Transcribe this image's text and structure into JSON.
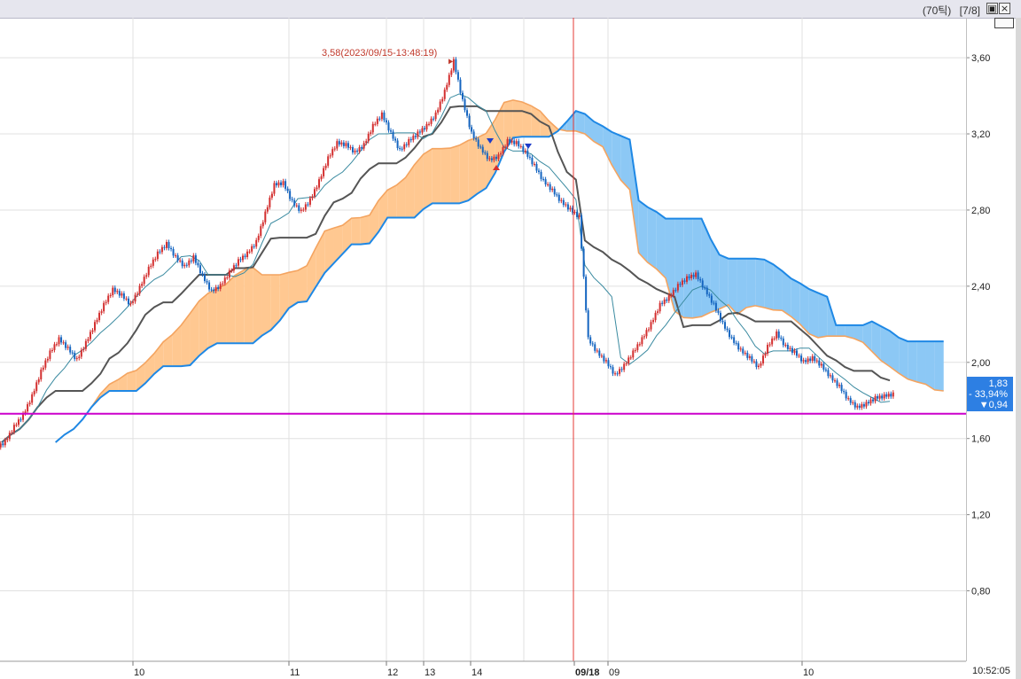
{
  "header": {
    "period_label": "(70틱)",
    "page_label": "[7/8]",
    "restore_icon": "window-restore-icon",
    "close_label": "×"
  },
  "colors": {
    "background": "#ffffff",
    "grid": "#e0e0e0",
    "candle_up": "#d32f2f",
    "candle_down": "#1565c0",
    "base_line": "#555555",
    "conversion_line": "#3a8aa0",
    "span_a": "#f4a460",
    "span_b": "#1e88e5",
    "cloud_bull": "#ffc891",
    "cloud_bear": "#8cc8f5",
    "support_line": "#cc00cc",
    "cursor_line": "#e53935",
    "badge": "#2d7fe3"
  },
  "chart_data": {
    "type": "candlestick",
    "indicator": "ichimoku",
    "y_ticks": [
      "3,60",
      "3,20",
      "2,80",
      "2,40",
      "2,00",
      "1,60",
      "1,20",
      "0,80"
    ],
    "y_tick_values": [
      3.6,
      3.2,
      2.8,
      2.4,
      2.0,
      1.6,
      1.2,
      0.8
    ],
    "ylim": [
      0.43,
      3.81
    ],
    "x_labels": [
      {
        "label": "10",
        "index": 0.0
      },
      {
        "label": "11",
        "index": 0.0
      },
      {
        "label": "12",
        "index": 0.0
      },
      {
        "label": "13",
        "index": 0.0
      },
      {
        "label": "14",
        "index": 0.0
      },
      {
        "label": "09/18",
        "index": 0.0
      },
      {
        "label": "09",
        "index": 0.0
      },
      {
        "label": "10",
        "index": 0.0
      }
    ],
    "x_labels_rendered": [
      "10",
      "11",
      "12",
      "13",
      "14",
      "09/18",
      "09",
      "10"
    ],
    "close_points": [
      [
        0,
        1.58
      ],
      [
        1,
        1.66
      ],
      [
        2,
        1.72
      ],
      [
        3,
        1.82
      ],
      [
        4,
        1.95
      ],
      [
        5,
        2.05
      ],
      [
        6,
        2.12
      ],
      [
        7,
        2.07
      ],
      [
        8,
        2.01
      ],
      [
        9,
        2.1
      ],
      [
        10,
        2.2
      ],
      [
        11,
        2.3
      ],
      [
        12,
        2.38
      ],
      [
        13,
        2.35
      ],
      [
        14,
        2.3
      ],
      [
        15,
        2.39
      ],
      [
        16,
        2.49
      ],
      [
        17,
        2.57
      ],
      [
        18,
        2.62
      ],
      [
        19,
        2.55
      ],
      [
        20,
        2.5
      ],
      [
        21,
        2.55
      ],
      [
        22,
        2.45
      ],
      [
        23,
        2.37
      ],
      [
        24,
        2.4
      ],
      [
        25,
        2.47
      ],
      [
        26,
        2.53
      ],
      [
        27,
        2.57
      ],
      [
        28,
        2.63
      ],
      [
        29,
        2.78
      ],
      [
        30,
        2.93
      ],
      [
        31,
        2.94
      ],
      [
        32,
        2.84
      ],
      [
        33,
        2.79
      ],
      [
        34,
        2.85
      ],
      [
        35,
        2.95
      ],
      [
        36,
        3.07
      ],
      [
        37,
        3.15
      ],
      [
        38,
        3.14
      ],
      [
        39,
        3.1
      ],
      [
        40,
        3.14
      ],
      [
        41,
        3.24
      ],
      [
        42,
        3.3
      ],
      [
        43,
        3.2
      ],
      [
        44,
        3.11
      ],
      [
        45,
        3.16
      ],
      [
        46,
        3.2
      ],
      [
        47,
        3.24
      ],
      [
        48,
        3.3
      ],
      [
        49,
        3.42
      ],
      [
        50,
        3.58
      ],
      [
        51,
        3.37
      ],
      [
        52,
        3.2
      ],
      [
        53,
        3.12
      ],
      [
        54,
        3.06
      ],
      [
        55,
        3.08
      ],
      [
        56,
        3.16
      ],
      [
        57,
        3.15
      ],
      [
        58,
        3.1
      ],
      [
        59,
        3.03
      ],
      [
        60,
        2.95
      ],
      [
        61,
        2.9
      ],
      [
        62,
        2.84
      ],
      [
        63,
        2.8
      ],
      [
        64,
        2.76
      ],
      [
        65,
        2.12
      ],
      [
        66,
        2.05
      ],
      [
        67,
        2.0
      ],
      [
        68,
        1.93
      ],
      [
        69,
        1.98
      ],
      [
        70,
        2.05
      ],
      [
        71,
        2.12
      ],
      [
        72,
        2.2
      ],
      [
        73,
        2.3
      ],
      [
        74,
        2.34
      ],
      [
        75,
        2.4
      ],
      [
        76,
        2.44
      ],
      [
        77,
        2.46
      ],
      [
        78,
        2.38
      ],
      [
        79,
        2.3
      ],
      [
        80,
        2.2
      ],
      [
        81,
        2.12
      ],
      [
        82,
        2.06
      ],
      [
        83,
        2.02
      ],
      [
        84,
        1.97
      ],
      [
        85,
        2.08
      ],
      [
        86,
        2.15
      ],
      [
        87,
        2.08
      ],
      [
        88,
        2.05
      ],
      [
        89,
        2.0
      ],
      [
        90,
        2.02
      ],
      [
        91,
        1.98
      ],
      [
        92,
        1.92
      ],
      [
        93,
        1.87
      ],
      [
        94,
        1.8
      ],
      [
        95,
        1.76
      ],
      [
        96,
        1.78
      ],
      [
        97,
        1.81
      ],
      [
        98,
        1.82
      ],
      [
        99,
        1.83
      ]
    ],
    "annotation": "3,58(2023/09/15-13:48:19)",
    "support_level": 1.73,
    "last_price": "1,83",
    "change_percent": "- 33,94%",
    "change_value": "▼0,94",
    "current_time": "10:52:05",
    "grid": true,
    "legend": "none"
  }
}
